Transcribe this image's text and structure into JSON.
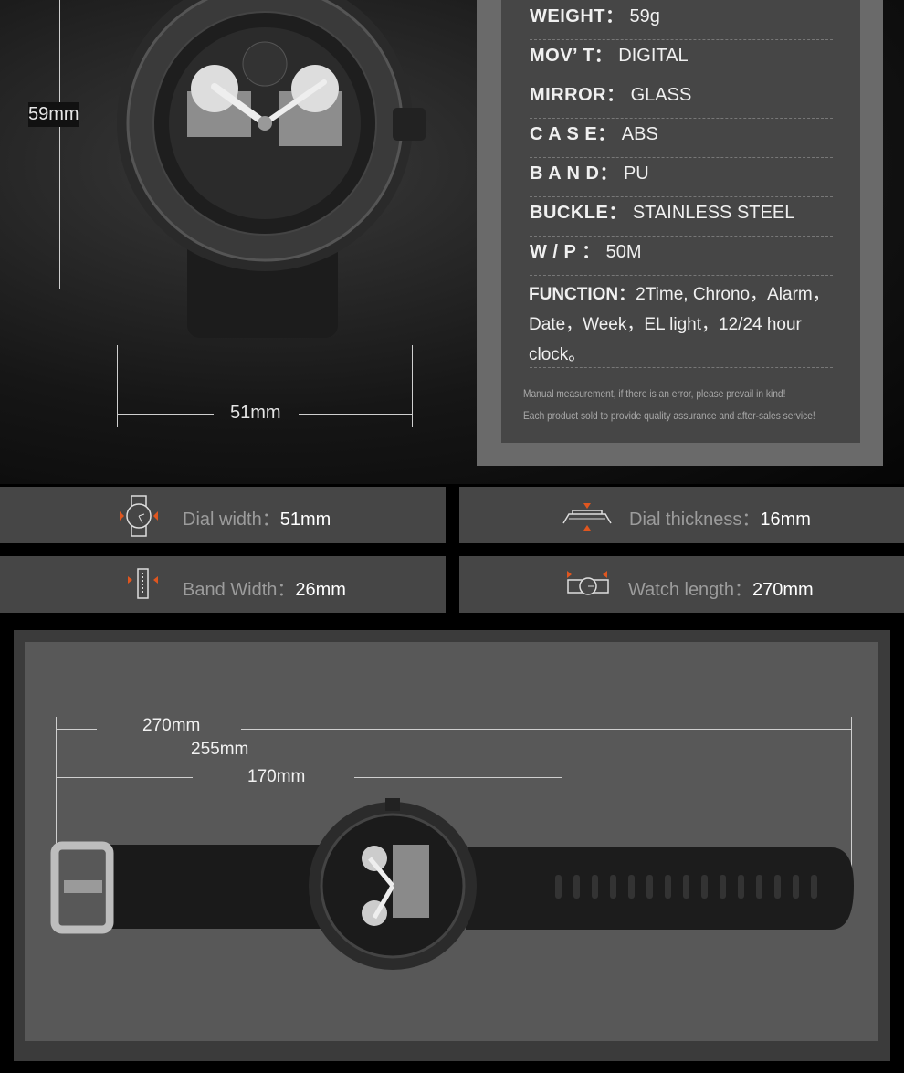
{
  "dimensions": {
    "height": "59mm",
    "width": "51mm"
  },
  "specs": [
    {
      "label": "WEIGHT",
      "value": "59g"
    },
    {
      "label": "MOV’ T",
      "value": "DIGITAL"
    },
    {
      "label": "MIRROR",
      "value": "GLASS"
    },
    {
      "label": "C A S E",
      "value": "ABS"
    },
    {
      "label": "B A N D",
      "value": "PU"
    },
    {
      "label": "BUCKLE",
      "value": "STAINLESS STEEL"
    },
    {
      "label": "W / P",
      "value": "50M"
    }
  ],
  "function": {
    "label": "FUNCTION",
    "value": "2Time, Chrono，Alarm，Date，Week，EL light，12/24 hour clock。"
  },
  "notes": [
    "Manual measurement, if there is an error, please prevail in kind!",
    "Each product sold to provide quality assurance and after-sales service!"
  ],
  "tiles": [
    {
      "icon": "dial-width-icon",
      "label": "Dial width：",
      "value": "51mm"
    },
    {
      "icon": "dial-thickness-icon",
      "label": "Dial thickness：",
      "value": "16mm"
    },
    {
      "icon": "band-width-icon",
      "label": "Band Width：",
      "value": "26mm"
    },
    {
      "icon": "watch-length-icon",
      "label": "Watch length：",
      "value": "270mm"
    }
  ],
  "lengths": [
    "270mm",
    "255mm",
    "170mm"
  ],
  "colors": {
    "accent": "#e0561f",
    "panel": "#464646",
    "panel_border": "#6a6a6a"
  }
}
